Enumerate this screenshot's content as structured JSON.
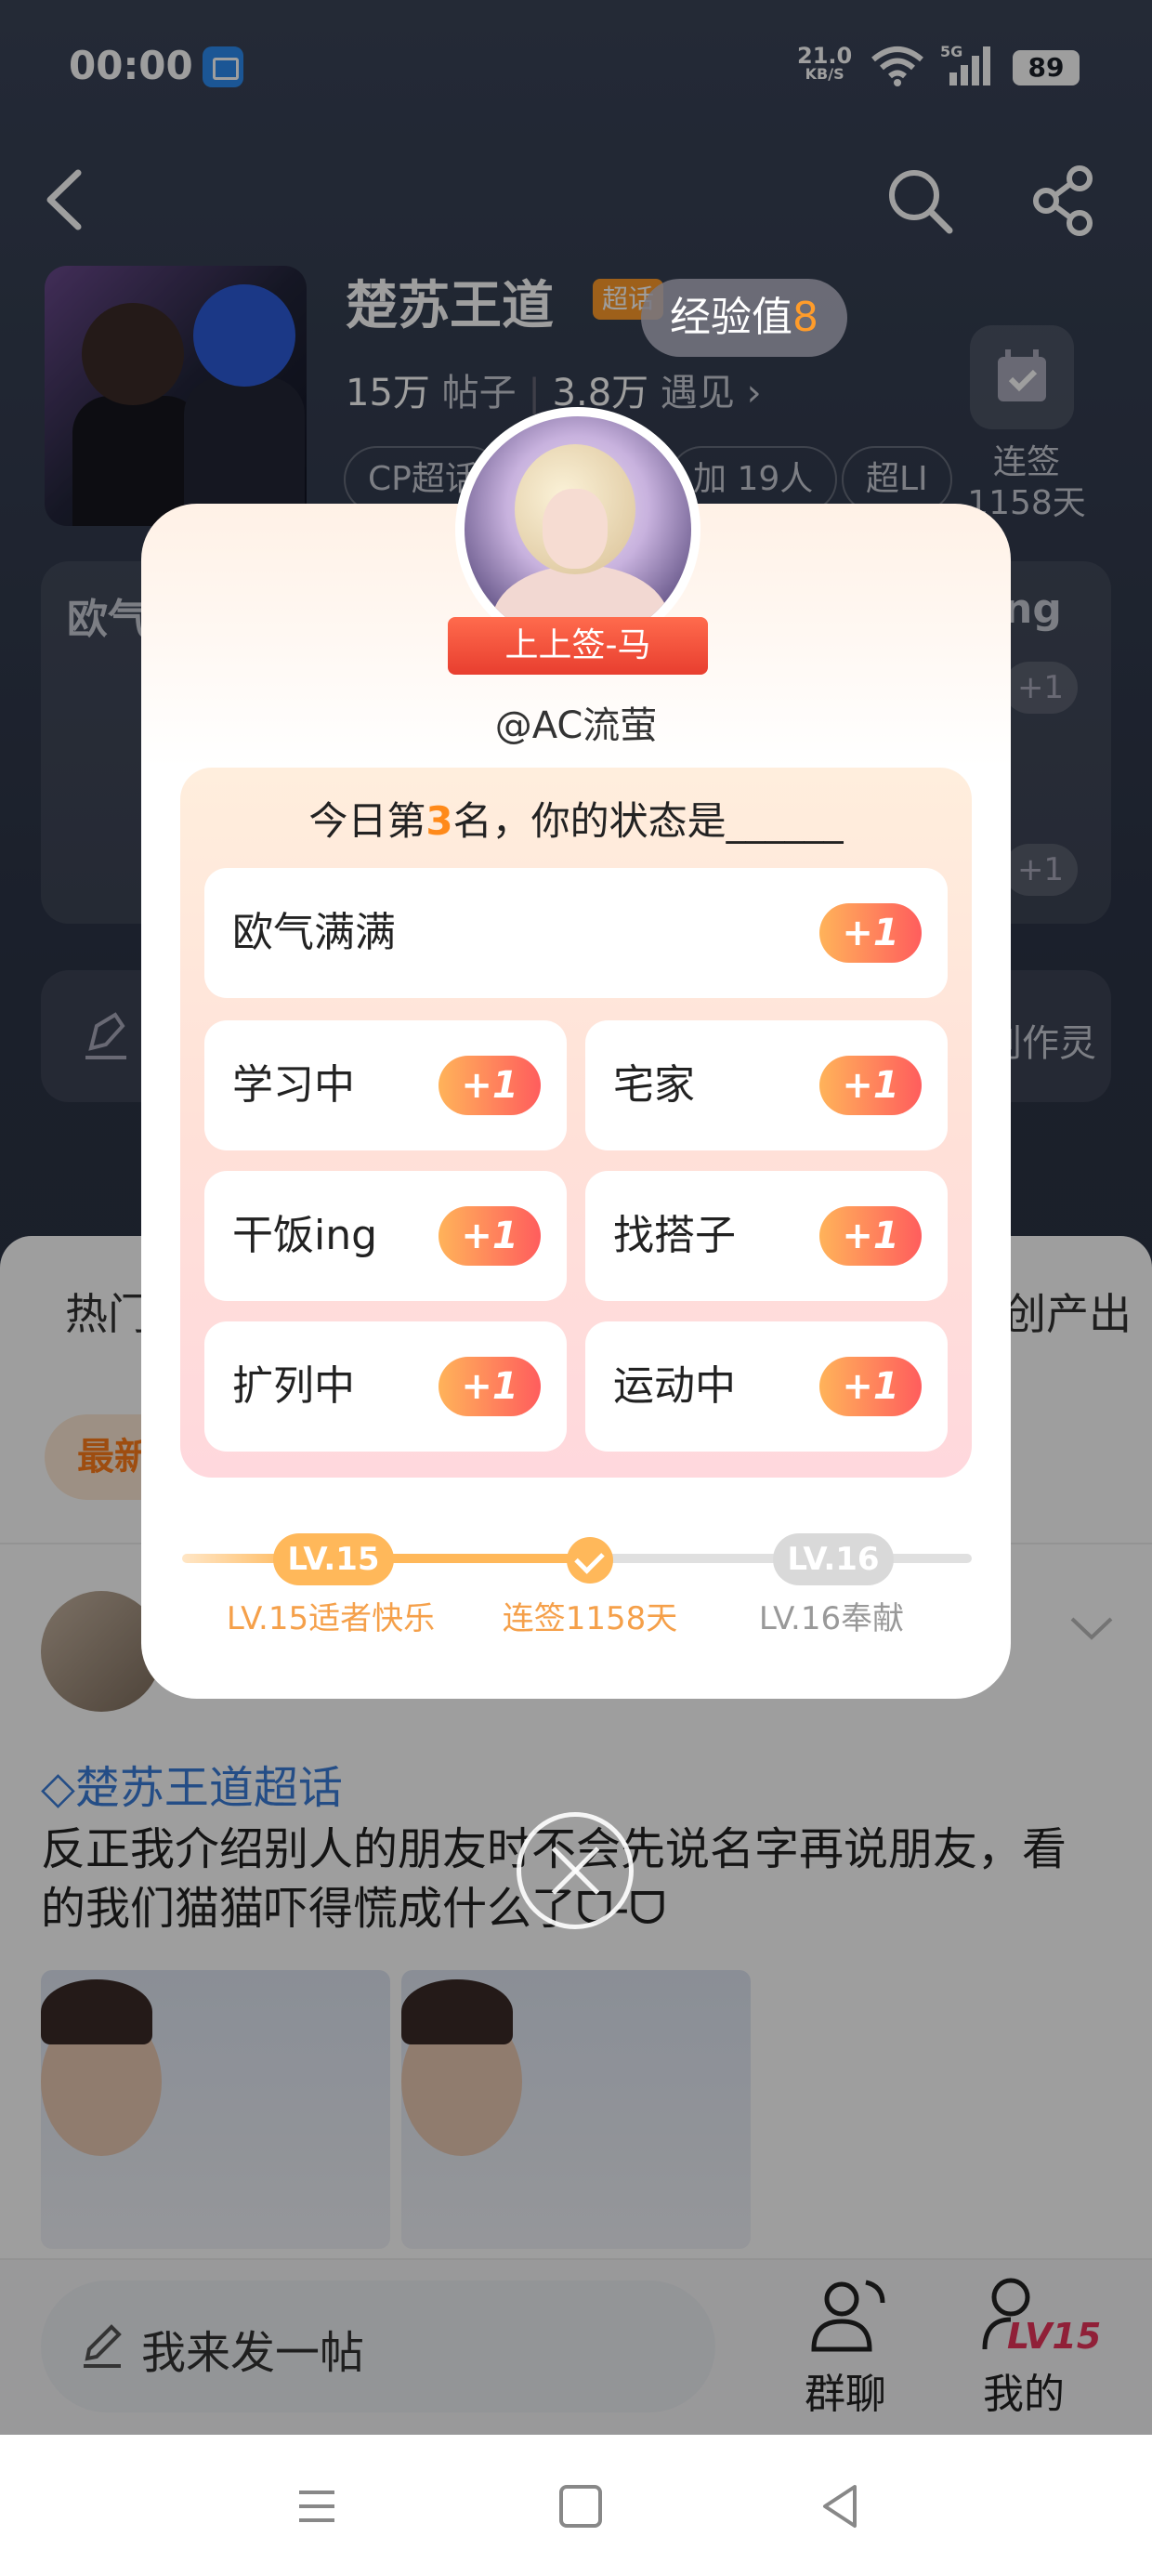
{
  "status_bar": {
    "time": "00:00",
    "net_speed_value": "21.0",
    "net_speed_unit": "KB/S",
    "network_type": "5G",
    "battery": "89"
  },
  "header": {
    "back": "back-icon",
    "search": "search-icon",
    "share": "share-icon"
  },
  "topic": {
    "title": "楚苏王道",
    "badge": "超话",
    "posts_count": "15万",
    "posts_label": "帖子",
    "meet_count": "3.8万",
    "meet_label": "遇见",
    "chips": [
      "CP超话",
      "加 19人",
      "超LI"
    ],
    "checkin_label_line1": "连签",
    "checkin_label_line2": "1158天"
  },
  "exp_toast": {
    "label": "经验值",
    "value": "8"
  },
  "background_card": {
    "title": "欧气",
    "title_right": "ng",
    "plus": "+1"
  },
  "background_create": {
    "label": "创作灵"
  },
  "feed": {
    "tabs": [
      "热门",
      "原创产出"
    ],
    "pill": "最新",
    "post": {
      "topic": "楚苏王道超话",
      "text": "反正我介绍别人的朋友时不会先说名字再说朋友，看的我们猫猫吓得慌成什么了ᗜ-ᗜ"
    }
  },
  "bottom_bar": {
    "compose": "我来发一帖",
    "group": "群聊",
    "mine": "我的",
    "mine_level": "LV15"
  },
  "dialog": {
    "ribbon": "上上签-马",
    "username": "@AC流萤",
    "question_prefix": "今日第",
    "rank": "3",
    "question_suffix": "名，你的状态是______",
    "options": [
      {
        "label": "欧气满满",
        "plus": "+1"
      },
      {
        "label": "学习中",
        "plus": "+1"
      },
      {
        "label": "宅家",
        "plus": "+1"
      },
      {
        "label": "干饭ing",
        "plus": "+1"
      },
      {
        "label": "找搭子",
        "plus": "+1"
      },
      {
        "label": "扩列中",
        "plus": "+1"
      },
      {
        "label": "运动中",
        "plus": "+1"
      }
    ],
    "level": {
      "current": "LV.15",
      "current_caption": "LV.15适者快乐",
      "streak_caption": "连签1158天",
      "next": "LV.16",
      "next_caption": "LV.16奉献"
    }
  },
  "colors": {
    "accent": "#ff8a1a",
    "plus_gradient_start": "#ffb35a",
    "plus_gradient_end": "#ff5d5d",
    "link": "#3b7dd8",
    "level_pink": "#e8345b"
  }
}
